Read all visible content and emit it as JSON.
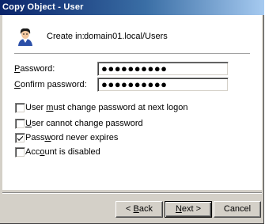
{
  "window": {
    "title": "Copy Object - User"
  },
  "header": {
    "icon": "user-icon",
    "create_in_label": "Create in:",
    "create_in_path": "domain01.local/Users"
  },
  "fields": {
    "password_label_first": "P",
    "password_label_rest": "assword:",
    "password_value": "●●●●●●●●●●",
    "confirm_label_first": "C",
    "confirm_label_rest": "onfirm password:",
    "confirm_value": "●●●●●●●●●●"
  },
  "options": [
    {
      "pre": "User ",
      "key": "m",
      "post": "ust change password at next logon",
      "checked": false
    },
    {
      "pre": "",
      "key": "U",
      "post": "ser cannot change password",
      "checked": false
    },
    {
      "pre": "Pass",
      "key": "w",
      "post": "ord never expires",
      "checked": true
    },
    {
      "pre": "Acc",
      "key": "o",
      "post": "unt is disabled",
      "checked": false
    }
  ],
  "buttons": {
    "back_arrow": "< ",
    "back_key": "B",
    "back_rest": "ack",
    "next_key": "N",
    "next_rest": "ext >",
    "cancel": "Cancel"
  }
}
